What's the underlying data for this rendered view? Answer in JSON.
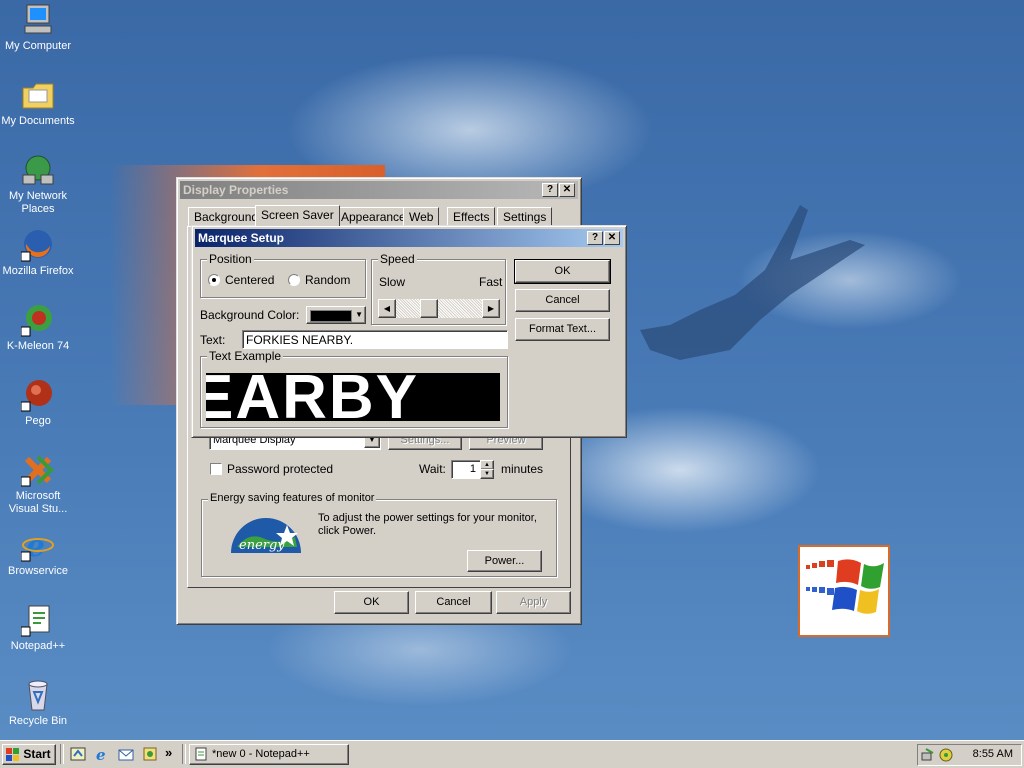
{
  "desktop": {
    "icons": [
      {
        "label": "My Computer",
        "icon": "computer-icon"
      },
      {
        "label": "My Documents",
        "icon": "folder-icon"
      },
      {
        "label": "My Network Places",
        "icon": "network-icon"
      },
      {
        "label": "Mozilla Firefox",
        "icon": "firefox-icon"
      },
      {
        "label": "K-Meleon 74",
        "icon": "kmeleon-icon"
      },
      {
        "label": "Pego",
        "icon": "pego-icon"
      },
      {
        "label": "Microsoft Visual Stu...",
        "icon": "visual-studio-icon"
      },
      {
        "label": "Browservice",
        "icon": "ie-icon"
      },
      {
        "label": "Notepad++",
        "icon": "notepadpp-icon"
      },
      {
        "label": "Recycle Bin",
        "icon": "recycle-bin-icon"
      }
    ]
  },
  "display_properties": {
    "title": "Display Properties",
    "tabs": [
      "Background",
      "Screen Saver",
      "Appearance",
      "Web",
      "Effects",
      "Settings"
    ],
    "active_tab": "Screen Saver",
    "screensaver_value": "Marquee Display",
    "settings_button": "Settings...",
    "preview_button": "Preview",
    "password_label": "Password protected",
    "password_checked": false,
    "wait_label": "Wait:",
    "wait_value": "1",
    "minutes_label": "minutes",
    "energy_group": "Energy saving features of monitor",
    "energy_text": "To adjust the power settings for your monitor, click Power.",
    "power_button": "Power...",
    "ok": "OK",
    "cancel": "Cancel",
    "apply": "Apply"
  },
  "marquee_setup": {
    "title": "Marquee Setup",
    "position_label": "Position",
    "centered_label": "Centered",
    "random_label": "Random",
    "position_selected": "Centered",
    "speed_label": "Speed",
    "slow_label": "Slow",
    "fast_label": "Fast",
    "speed_value": 0.35,
    "bg_color_label": "Background Color:",
    "bg_color": "#000000",
    "text_label": "Text:",
    "text_value": "FORKIES NEARBY.",
    "text_example_label": "Text Example",
    "example_text": "EARBY",
    "ok": "OK",
    "cancel": "Cancel",
    "format_text": "Format Text..."
  },
  "taskbar": {
    "start": "Start",
    "task": "*new  0 - Notepad++",
    "clock": "8:55 AM",
    "chevron": "»"
  }
}
